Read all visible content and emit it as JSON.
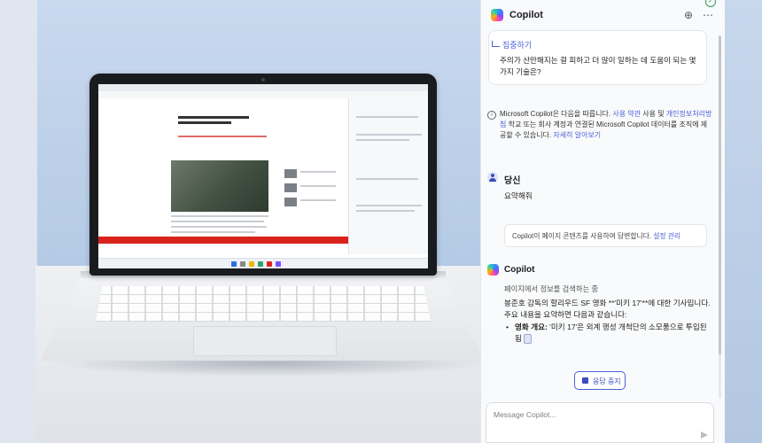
{
  "header": {
    "title": "Copilot",
    "new_chat_icon": "plus-circle-icon",
    "more_icon": "ellipsis-icon",
    "shield_icon": "shield-check-icon"
  },
  "suggestion_card": {
    "tag": "집중하기",
    "text": "주의가 산만해지는 걸 피하고 더 많이 일하는 데 도움이 되는 몇 가지 기술은?"
  },
  "notice": {
    "part1": "Microsoft Copilot은 다음을 따릅니다. ",
    "link_terms": "사용 약관",
    "part2": " 사용 및 ",
    "link_privacy": "개인정보처리방침",
    "part3": " 학교 또는 회사 계정과 연결된 Microsoft Copilot 데이터를 조직에 제공할 수 있습니다. ",
    "link_more": "자세히 알아보기"
  },
  "user_message": {
    "name": "당신",
    "text": "요약해줘"
  },
  "context_note": {
    "text": "Copilot이 페이지 콘텐츠를 사용하여 답변합니다. ",
    "link": "설정 관리"
  },
  "copilot_message": {
    "name": "Copilot",
    "status": "페이지에서 정보를 검색하는 중",
    "body": "봉준호 감독의 할리우드 SF 영화 **'미키 17'**에 대한 기사입니다. 주요 내용을 요약하면 다음과 같습니다:",
    "bullet_label": "영화 개요:",
    "bullet_text": " '미키 17'은 외계 행성 개척단의 소모품으로 투입된"
  },
  "stop_button": {
    "label": "응답 중지"
  },
  "composer": {
    "placeholder": "Message Copilot...",
    "send_icon": "send-icon"
  },
  "colors": {
    "accent": "#4a5fd8",
    "panel_bg": "#f9fafb",
    "brand_red": "#d9231d"
  }
}
